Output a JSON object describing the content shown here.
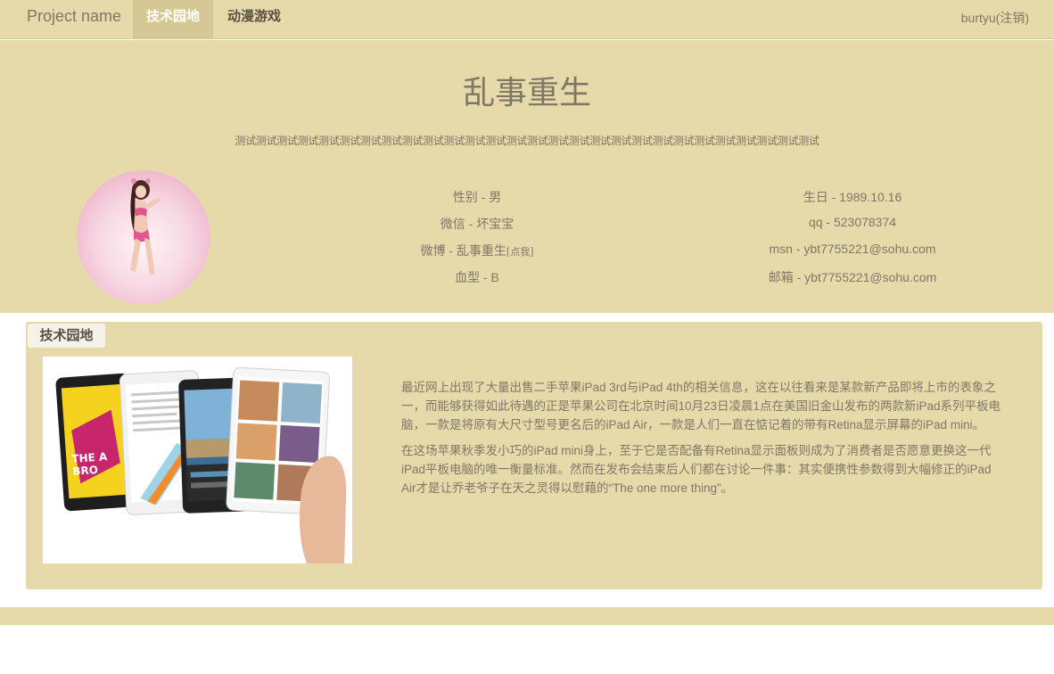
{
  "navbar": {
    "brand": "Project name",
    "tabs": [
      {
        "label": "技术园地",
        "active": true
      },
      {
        "label": "动漫游戏",
        "active": false
      }
    ],
    "user": "burtyu(注销)"
  },
  "hero": {
    "title": "乱事重生",
    "subtitle": "测试测试测试测试测试测试测试测试测试测试测试测试测试测试测试测试测试测试测试测试测试测试测试测试测试测试测试测试",
    "info_left": [
      {
        "text": "性别 - 男"
      },
      {
        "text": "微信 - 坏宝宝"
      },
      {
        "text": "微博 - 乱事重生",
        "suffix": "[点我]"
      },
      {
        "text": "血型 - B"
      }
    ],
    "info_right": [
      {
        "text": "生日 - 1989.10.16"
      },
      {
        "text": "qq - 523078374"
      },
      {
        "text": "msn - ybt7755221@sohu.com"
      },
      {
        "text": "邮箱 - ybt7755221@sohu.com"
      }
    ]
  },
  "panel": {
    "label": "技术园地",
    "paragraphs": [
      "最近网上出现了大量出售二手苹果iPad 3rd与iPad 4th的相关信息，这在以往看来是某款新产品即将上市的表象之一，而能够获得如此待遇的正是苹果公司在北京时间10月23日凌晨1点在美国旧金山发布的两款新iPad系列平板电脑，一款是将原有大尺寸型号更名后的iPad Air，一款是人们一直在惦记着的带有Retina显示屏幕的iPad mini。",
      "在这场苹果秋季发小巧的iPad mini身上，至于它是否配备有Retina显示面板则成为了消费者是否愿意更换这一代iPad平板电脑的唯一衡量标准。然而在发布会结束后人们都在讨论一件事：其实便携性参数得到大幅修正的iPad Air才是让乔老爷子在天之灵得以慰藉的“The one more thing”。"
    ]
  },
  "colors": {
    "band": "#e6daab",
    "active_tab": "#d6c895",
    "text": "#807766"
  }
}
